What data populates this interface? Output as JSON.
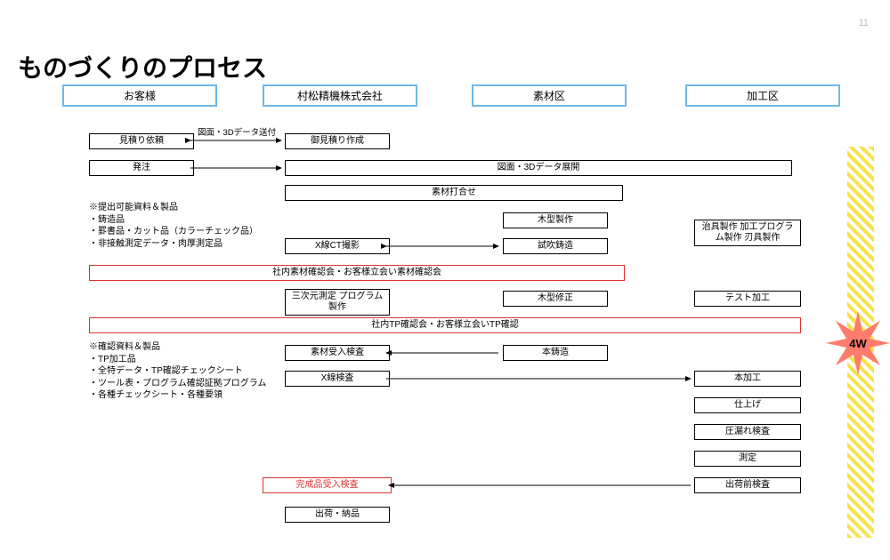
{
  "page_number": "11",
  "title": "ものづくりのプロセス",
  "lanes": {
    "c1": "お客様",
    "c2": "村松精機株式会社",
    "c3": "素材区",
    "c4": "加工区"
  },
  "edge_label": "図面・3Dデータ送付",
  "boxes": {
    "b_estreq": "見積り依頼",
    "b_estmake": "御見積り作成",
    "b_order": "発注",
    "b_deploy": "図面・3Dデータ展開",
    "b_meet": "素材打合せ",
    "b_wood": "木型製作",
    "b_jig": "治具製作\n加工プログラム製作\n刃具製作",
    "b_ct": "X線CT撮影",
    "b_trial": "試吹鋳造",
    "b_redwide1": "社内素材確認会・お客様立会い素材確認会",
    "b_3d": "三次元測定\nプログラム製作",
    "b_woodfix": "木型修正",
    "b_test": "テスト加工",
    "b_redwide2": "社内TP確認会・お客様立会いTP確認",
    "b_recv": "素材受入検査",
    "b_maincasting": "本鋳造",
    "b_xray": "X線検査",
    "b_mainproc": "本加工",
    "b_finish": "仕上げ",
    "b_leak": "圧漏れ検査",
    "b_measure": "測定",
    "b_pre": "出荷前検査",
    "b_final": "完成品受入検査",
    "b_ship": "出荷・納品"
  },
  "notes": {
    "n1": "※提出可能資料＆製品\n・鋳造品\n・罫書品・カット品（カラーチェック品）\n・非接触測定データ・肉厚測定品",
    "n2": "※確認資料＆製品\n・TP加工品\n・全特データ・TP確認チェックシート\n・ツール表・プログラム確認証拠プログラム\n・各種チェックシート・各種要領"
  },
  "badge": "4W"
}
